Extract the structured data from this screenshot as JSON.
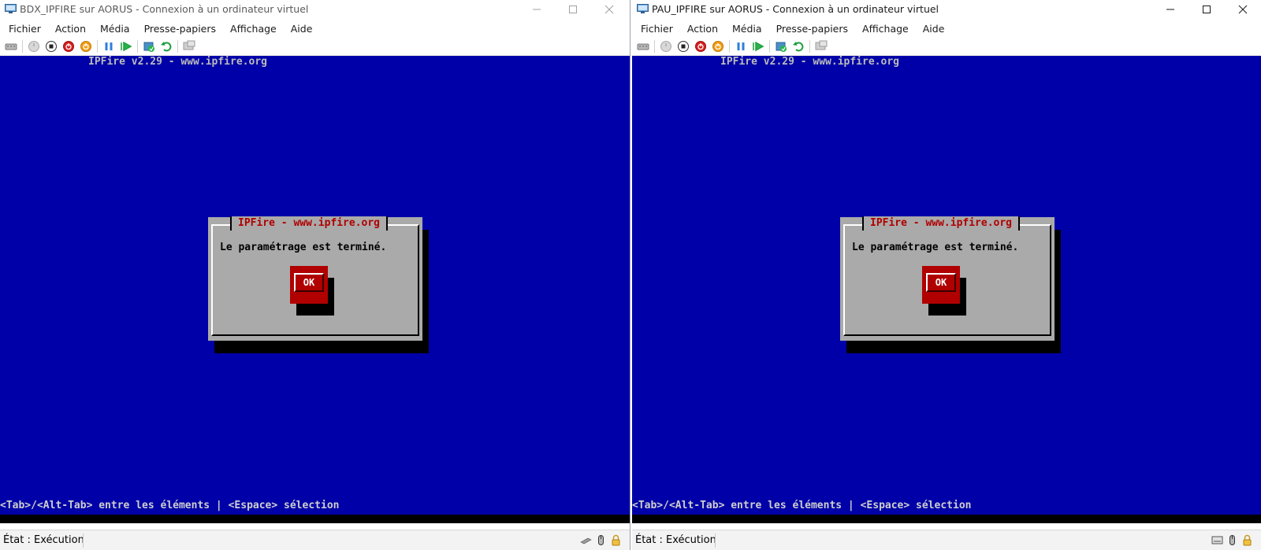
{
  "windows": [
    {
      "title": "BDX_IPFIRE sur AORUS - Connexion à un ordinateur virtuel",
      "menu": [
        "Fichier",
        "Action",
        "Média",
        "Presse-papiers",
        "Affichage",
        "Aide"
      ],
      "console": {
        "header": "IPFire v2.29 - www.ipfire.org",
        "dialog_title": "IPFire - www.ipfire.org",
        "dialog_message": "Le paramétrage est terminé.",
        "ok_label": "OK",
        "help_line": "<Tab>/<Alt-Tab> entre les éléments | <Espace> sélection"
      },
      "status": "État : Exécution"
    },
    {
      "title": "PAU_IPFIRE sur AORUS - Connexion à un ordinateur virtuel",
      "menu": [
        "Fichier",
        "Action",
        "Média",
        "Presse-papiers",
        "Affichage",
        "Aide"
      ],
      "console": {
        "header": "IPFire v2.29 - www.ipfire.org",
        "dialog_title": "IPFire - www.ipfire.org",
        "dialog_message": "Le paramétrage est terminé.",
        "ok_label": "OK",
        "help_line": "<Tab>/<Alt-Tab> entre les éléments | <Espace> sélection"
      },
      "status": "État : Exécution"
    }
  ],
  "toolbar_icons": [
    "ctrl-alt-del-icon",
    "start-icon",
    "turn-off-icon",
    "shut-down-icon",
    "save-icon",
    "pause-icon",
    "resume-icon",
    "checkpoint-icon",
    "revert-icon",
    "enhanced-session-icon"
  ],
  "colors": {
    "console_background": "#0000a8",
    "dialog_background": "#aaaaaa",
    "dialog_title_text": "#b00000",
    "ok_button": "#b00000",
    "header_text": "#bcbcbc"
  }
}
